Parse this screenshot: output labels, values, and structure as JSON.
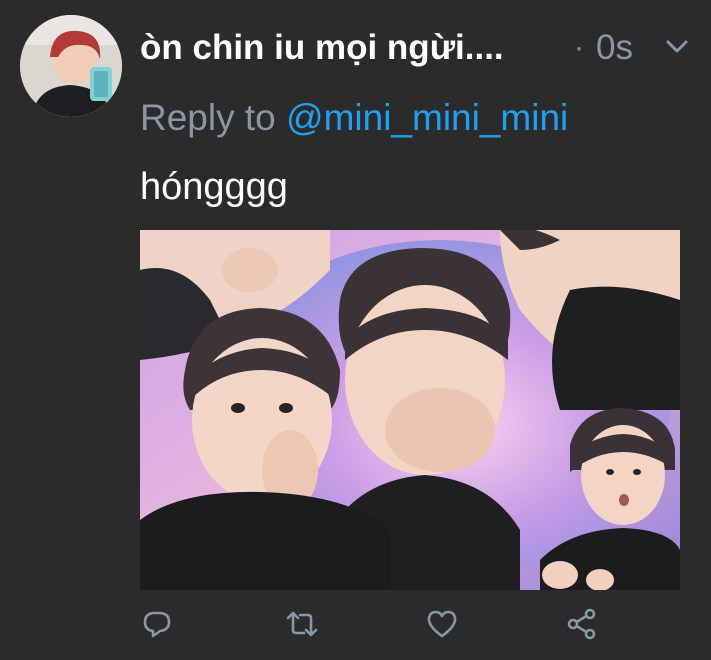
{
  "tweet": {
    "display_name": "òn chin iu mọi ngừi....",
    "dot": "·",
    "timestamp": "0s",
    "reply_prefix": "Reply to",
    "reply_handle": "@mini_mini_mini",
    "text": "hóngggg"
  },
  "icons": {
    "menu": "chevron-down-icon",
    "reply": "reply-icon",
    "retweet": "retweet-icon",
    "like": "heart-icon",
    "share": "share-icon"
  },
  "colors": {
    "background": "#2b2b2b",
    "text_primary": "#ffffff",
    "text_secondary": "#8a96a3",
    "link": "#1da1f2"
  }
}
